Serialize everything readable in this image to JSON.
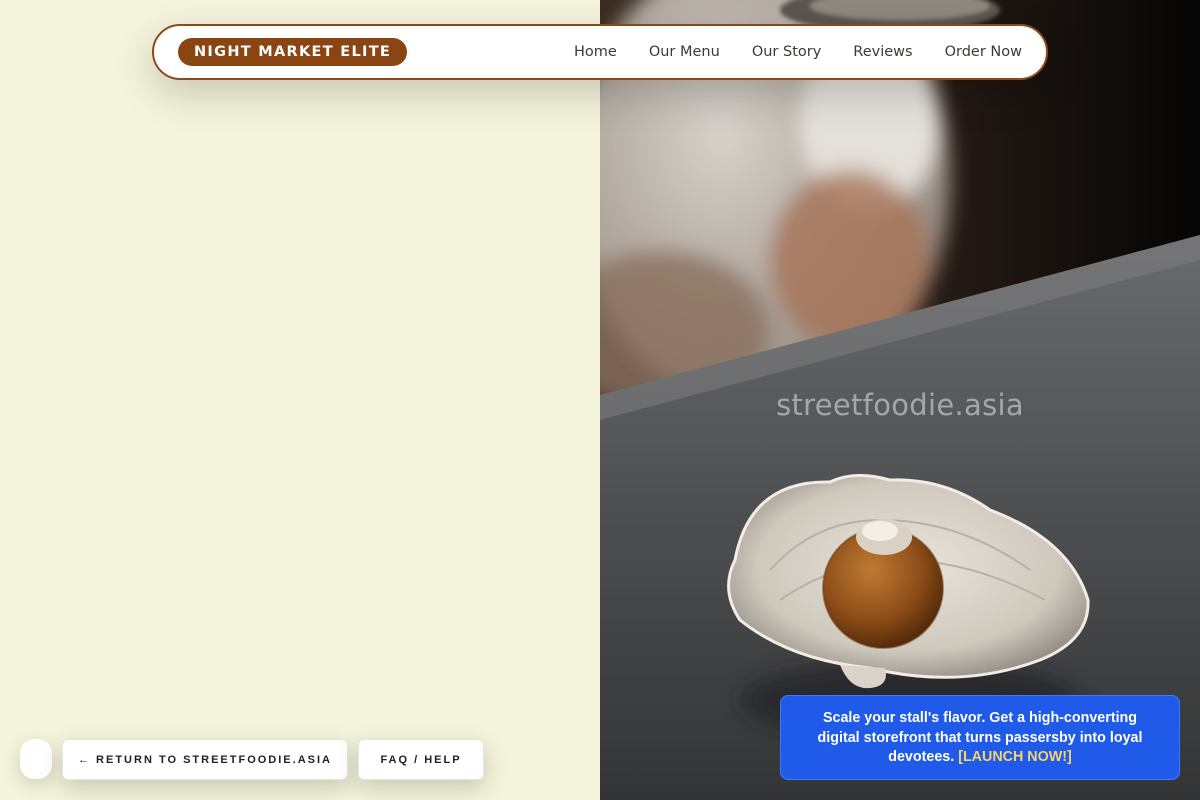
{
  "brand": {
    "label": "NIGHT MARKET ELITE"
  },
  "nav": {
    "links": [
      {
        "label": "Home"
      },
      {
        "label": "Our Menu"
      },
      {
        "label": "Our Story"
      },
      {
        "label": "Reviews"
      },
      {
        "label": "Order Now"
      }
    ]
  },
  "hero": {
    "watermark": "streetfoodie.asia"
  },
  "footer": {
    "return_label": "← RETURN TO STREETFOODIE.ASIA",
    "faq_label": "FAQ / HELP"
  },
  "promo": {
    "text": "Scale your stall's flavor. Get a high-converting digital storefront that turns passersby into loyal devotees.",
    "cta": "[LAUNCH NOW!]"
  },
  "colors": {
    "cream_bg": "#f4f3db",
    "brand_brown": "#8b4513",
    "promo_blue": "#1f5ae8",
    "cta_yellow": "#f7d36b"
  }
}
